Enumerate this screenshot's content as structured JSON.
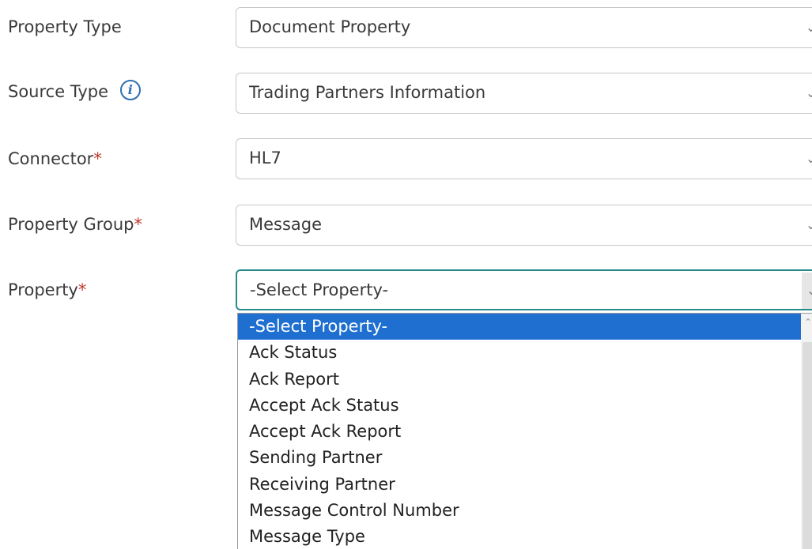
{
  "form": {
    "fields": [
      {
        "label": "Property Type",
        "required": false,
        "value": "Document Property"
      },
      {
        "label": "Source Type",
        "required": false,
        "value": "Trading Partners Information",
        "info_icon": "info-icon"
      },
      {
        "label": "Connector",
        "required": true,
        "value": "HL7"
      },
      {
        "label": "Property Group",
        "required": true,
        "value": "Message"
      },
      {
        "label": "Property",
        "required": true,
        "value": "-Select Property-",
        "focused": true
      }
    ],
    "required_marker": "*"
  },
  "dropdown": {
    "options": [
      "-Select Property-",
      "Ack Status",
      "Ack Report",
      "Accept Ack Status",
      "Accept Ack Report",
      "Sending Partner",
      "Receiving Partner",
      "Message Control Number",
      "Message Type"
    ],
    "selected_index": 0
  },
  "colors": {
    "required": "#c0392b",
    "focus_border": "#2a8a8a",
    "selected_bg": "#1f6fd1",
    "info_icon": "#2f6fb3"
  }
}
